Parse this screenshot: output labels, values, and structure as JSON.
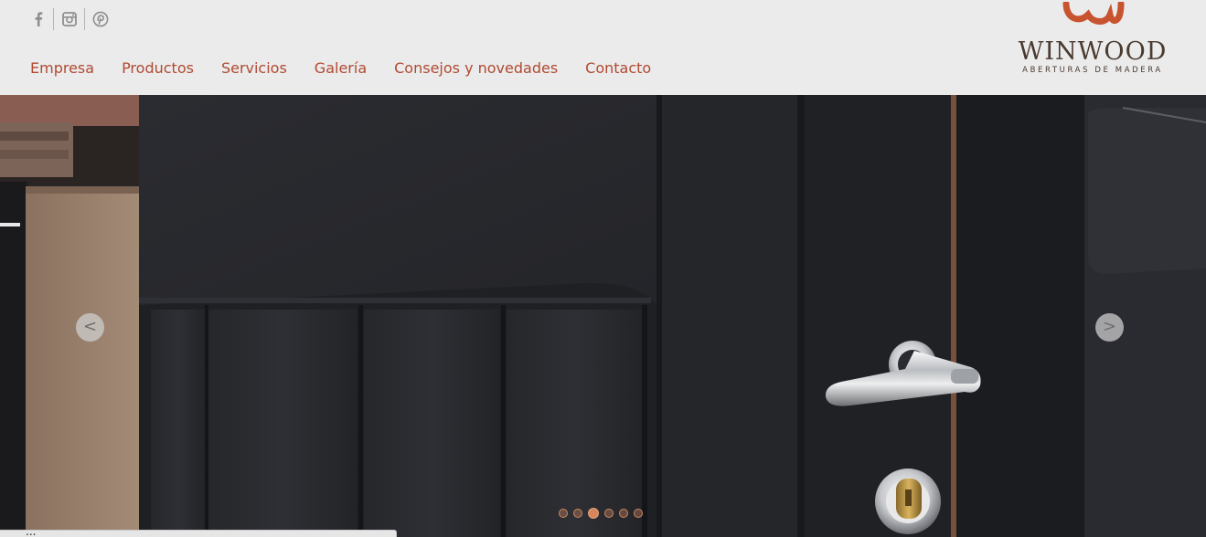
{
  "social": [
    {
      "name": "facebook-icon",
      "glyph": "f"
    },
    {
      "name": "instagram-icon"
    },
    {
      "name": "pinterest-icon"
    }
  ],
  "nav": {
    "items": [
      "Empresa",
      "Productos",
      "Servicios",
      "Galería",
      "Consejos y novedades",
      "Contacto"
    ]
  },
  "logo": {
    "wordmark": "WINWOOD",
    "tagline": "ABERTURAS DE MADERA"
  },
  "slider": {
    "prev_label": "<",
    "next_label": ">",
    "slide_count": 6,
    "active_slide": 3
  },
  "status_bar": {
    "url": "..."
  },
  "colors": {
    "nav_text": "#b04a33",
    "header_bg": "#ebebeb",
    "logo_mark": "#c8532f",
    "dot_accent": "#d8875c"
  }
}
